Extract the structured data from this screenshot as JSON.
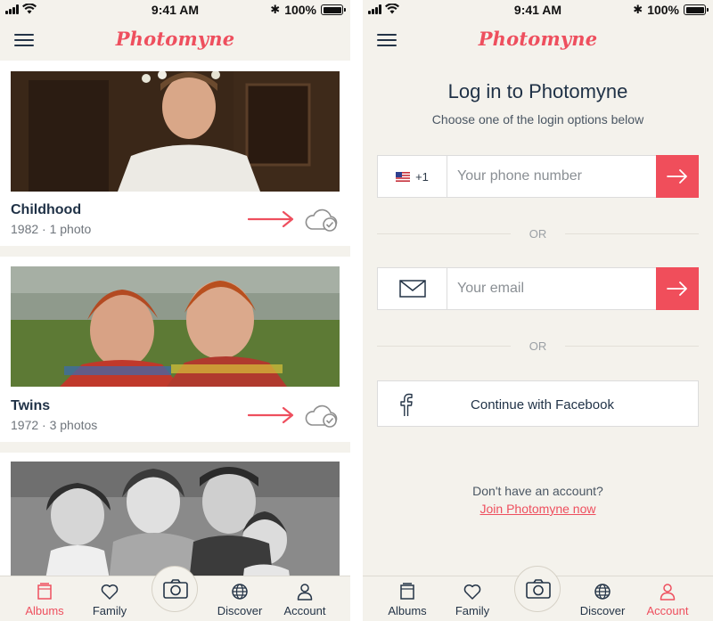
{
  "status_bar": {
    "time": "9:41 AM",
    "battery": "100%"
  },
  "app": {
    "logo": "Photomyne"
  },
  "albums": [
    {
      "title": "Childhood",
      "meta": "1982 · 1 photo"
    },
    {
      "title": "Twins",
      "meta": "1972 · 3 photos"
    },
    {
      "title": "",
      "meta": ""
    }
  ],
  "tabs": [
    {
      "label": "Albums",
      "icon": "albums-icon"
    },
    {
      "label": "Family",
      "icon": "heart-icon"
    },
    {
      "label": "Discover",
      "icon": "globe-icon"
    },
    {
      "label": "Account",
      "icon": "person-icon"
    }
  ],
  "left_active_tab": "Albums",
  "right_active_tab": "Account",
  "login": {
    "title": "Log in to Photomyne",
    "subtitle": "Choose one of the login options below",
    "country_code": "+1",
    "phone_placeholder": "Your phone number",
    "or_label": "OR",
    "email_placeholder": "Your email",
    "facebook_label": "Continue with Facebook",
    "no_account": "Don't have an account?",
    "join_link": "Join Photomyne now"
  },
  "colors": {
    "accent": "#ee4f5e",
    "navy": "#1f3146",
    "background": "#f4f2ec"
  }
}
